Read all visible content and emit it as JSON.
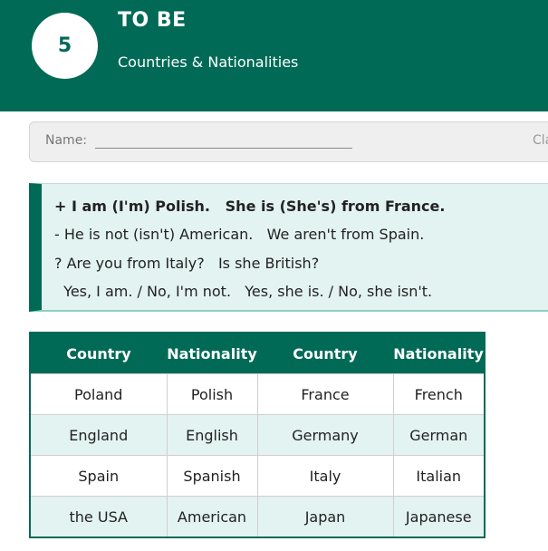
{
  "header": {
    "unit_number": "5",
    "title": "TO BE",
    "subtitle": "Countries & Nationalities"
  },
  "name_bar": {
    "name_label": "Name:",
    "class_label": "Cla"
  },
  "grammar": {
    "line1": "+ I am (I'm) Polish.   She is (She's) from France.",
    "line2": "- He is not (isn't) American.   We aren't from Spain.",
    "line3": "? Are you from Italy?   Is she British?",
    "line4": "  Yes, I am. / No, I'm not.   Yes, she is. / No, she isn't."
  },
  "table": {
    "headers": [
      "Country",
      "Nationality",
      "Country",
      "Nationality"
    ],
    "rows": [
      [
        "Poland",
        "Polish",
        "France",
        "French"
      ],
      [
        "England",
        "English",
        "Germany",
        "German"
      ],
      [
        "Spain",
        "Spanish",
        "Italy",
        "Italian"
      ],
      [
        "the USA",
        "American",
        "Japan",
        "Japanese"
      ]
    ]
  },
  "colors": {
    "primary": "#006a56",
    "light_tint": "#e3f3f1"
  }
}
